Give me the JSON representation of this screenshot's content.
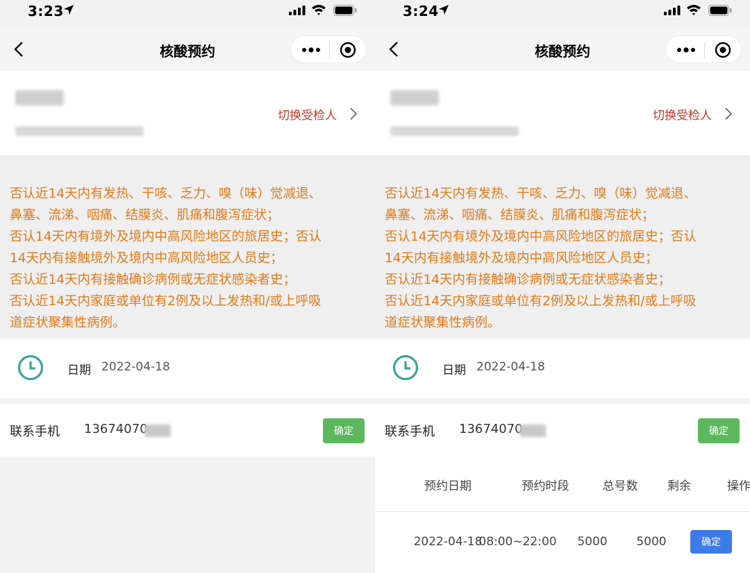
{
  "left": {
    "status_time": "3:23",
    "nav_title": "核酸预约",
    "switch_person": "切换受检人",
    "notice_lines": [
      "否认近14天内有发热、干咳、乏力、嗅（味）觉减退、",
      "鼻塞、流涕、咽痛、结膜炎、肌痛和腹泻症状；",
      "否认14天内有境外及境内中高风险地区的旅居史；否认",
      "14天内有接触境外及境内中高风险地区人员史；",
      "否认近14天内有接触确诊病例或无症状感染者史；",
      "否认近14天内家庭或单位有2例及以上发热和/或上呼吸",
      "道症状聚集性病例。"
    ],
    "date_label": "日期",
    "date_value": "2022-04-18",
    "phone_label": "联系手机",
    "phone_value": "13674070",
    "confirm_label": "确定"
  },
  "right": {
    "status_time": "3:24",
    "nav_title": "核酸预约",
    "switch_person": "切换受检人",
    "notice_lines": [
      "否认近14天内有发热、干咳、乏力、嗅（味）觉减退、",
      "鼻塞、流涕、咽痛、结膜炎、肌痛和腹泻症状；",
      "否认14天内有境外及境内中高风险地区的旅居史；否认",
      "14天内有接触境外及境内中高风险地区人员史；",
      "否认近14天内有接触确诊病例或无症状感染者史；",
      "否认近14天内家庭或单位有2例及以上发热和/或上呼吸",
      "道症状聚集性病例。"
    ],
    "date_label": "日期",
    "date_value": "2022-04-18",
    "phone_label": "联系手机",
    "phone_value": "13674070",
    "confirm_label": "确定",
    "table": {
      "headers": [
        "预约日期",
        "预约时段",
        "总号数",
        "剩余",
        "操作"
      ],
      "rows": [
        {
          "date": "2022-04-18",
          "slot": "08:00~22:00",
          "total": "5000",
          "remaining": "5000",
          "action": "确定"
        }
      ]
    }
  },
  "colors": {
    "notice_text": "#e07a18",
    "switch_text": "#c0392b",
    "confirm_green": "#5cb85c",
    "confirm_blue": "#3d7be8",
    "clock_teal": "#3aa59a"
  },
  "icons": [
    "location-arrow-icon",
    "signal-icon",
    "wifi-icon",
    "battery-icon",
    "back-chevron-icon",
    "more-dots-icon",
    "target-icon",
    "chevron-right-icon",
    "clock-icon"
  ]
}
